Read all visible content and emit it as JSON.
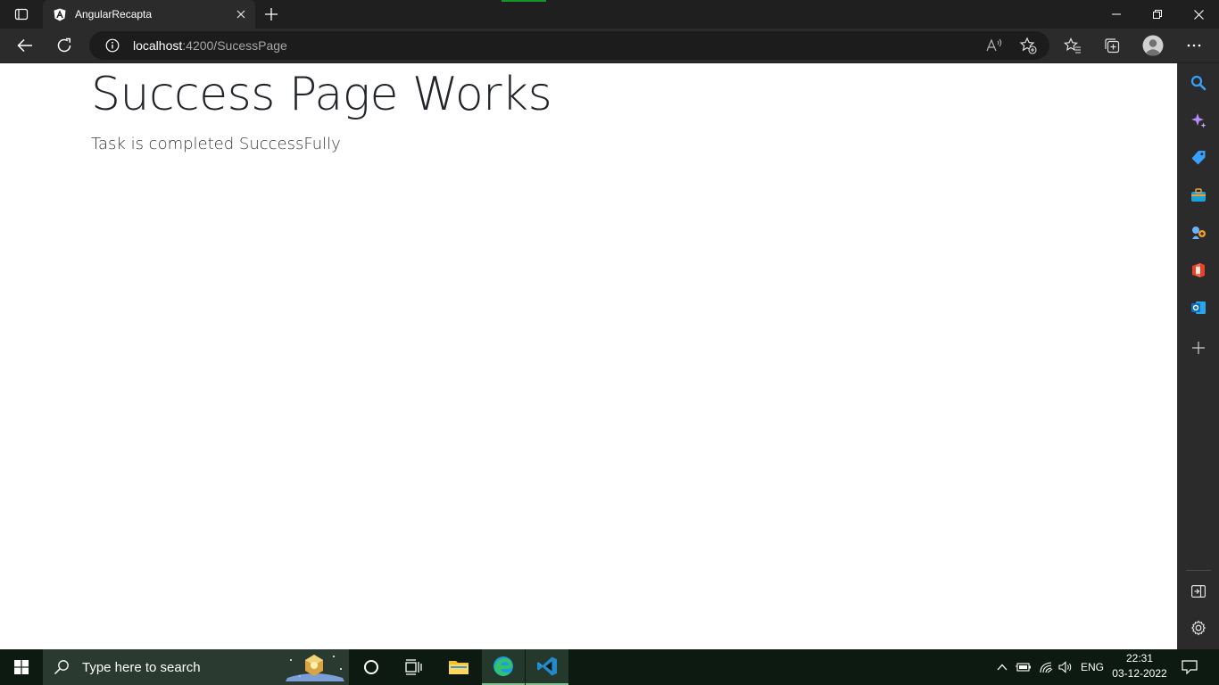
{
  "browser": {
    "tab": {
      "title": "AngularRecapta"
    },
    "address": {
      "host": "localhost",
      "rest": ":4200/SucessPage"
    }
  },
  "page": {
    "heading": "Success Page Works",
    "subtitle": "Task is completed SuccessFully"
  },
  "taskbar": {
    "search_placeholder": "Type here to search",
    "language": "ENG",
    "time": "22:31",
    "date": "03-12-2022"
  }
}
